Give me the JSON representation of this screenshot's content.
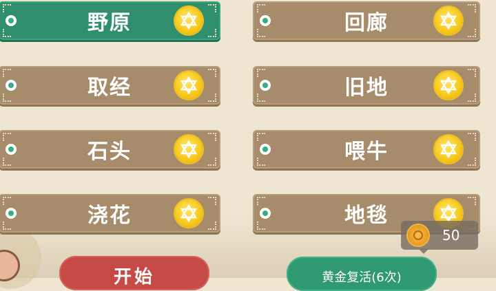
{
  "tiles": [
    {
      "label": "野原",
      "active": true
    },
    {
      "label": "回廊",
      "active": false
    },
    {
      "label": "取经",
      "active": false
    },
    {
      "label": "旧地",
      "active": false
    },
    {
      "label": "石头",
      "active": false
    },
    {
      "label": "喂牛",
      "active": false
    },
    {
      "label": "浇花",
      "active": false
    },
    {
      "label": "地毯",
      "active": false
    }
  ],
  "coin_counter": {
    "amount": "50"
  },
  "buttons": {
    "start": "开始",
    "revive": "黄金复活(6次)"
  },
  "colors": {
    "tile_active": "#2f8f6c",
    "tile_default": "#a78c6b",
    "start_button": "#c64a46",
    "revive_button": "#2f9a72"
  }
}
